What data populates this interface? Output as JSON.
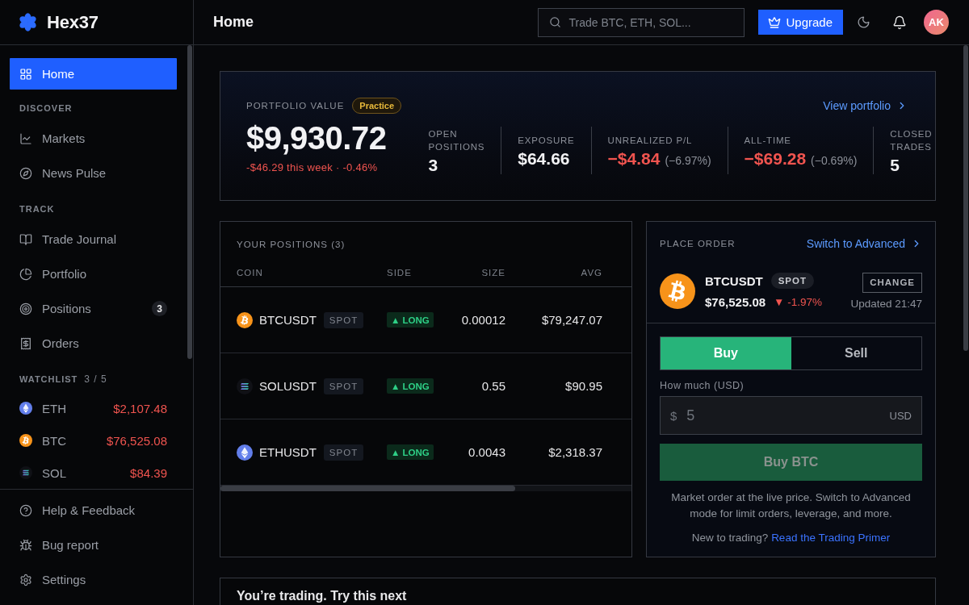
{
  "brand": {
    "name": "Hex37"
  },
  "sidebar": {
    "items": [
      {
        "kind": "home",
        "label": "Home",
        "selected": true
      }
    ],
    "sections": [
      {
        "title": "DISCOVER",
        "items": [
          {
            "kind": "markets",
            "label": "Markets",
            "selected": false
          },
          {
            "kind": "news",
            "label": "News Pulse",
            "selected": false
          }
        ]
      },
      {
        "title": "TRACK",
        "items": [
          {
            "kind": "journal",
            "label": "Trade Journal",
            "selected": false
          },
          {
            "kind": "portfolio",
            "label": "Portfolio",
            "selected": false
          },
          {
            "kind": "positions",
            "label": "Positions",
            "badge": "3",
            "selected": false
          },
          {
            "kind": "orders",
            "label": "Orders",
            "selected": false
          }
        ]
      }
    ],
    "watchlist": {
      "title": "WATCHLIST",
      "count": "3 / 5",
      "items": [
        {
          "kind": "eth",
          "symbol": "ETH",
          "price": "$2,107.48",
          "negative": true
        },
        {
          "kind": "btc",
          "symbol": "BTC",
          "price": "$76,525.08",
          "negative": true
        },
        {
          "kind": "sol",
          "symbol": "SOL",
          "price": "$84.39",
          "negative": true
        }
      ]
    },
    "footer_items": [
      {
        "kind": "help",
        "label": "Help & Feedback",
        "selected": false
      },
      {
        "kind": "bug",
        "label": "Bug report",
        "selected": false
      },
      {
        "kind": "settings",
        "label": "Settings",
        "selected": false
      }
    ]
  },
  "header": {
    "title": "Home",
    "search": {
      "placeholder": "Trade BTC, ETH, SOL..."
    },
    "upgrade": "Upgrade",
    "avatar": "AK"
  },
  "portfolio": {
    "label": "PORTFOLIO VALUE",
    "badge": "Practice",
    "value": "$9,930.72",
    "change": "-$46.29 this week · -0.46%",
    "change_negative": true,
    "link": "View portfolio",
    "stats": [
      {
        "label": "OPEN POSITIONS",
        "value": "3",
        "negative": false
      },
      {
        "label": "EXPOSURE",
        "value": "$64.66",
        "negative": false
      },
      {
        "label": "UNREALIZED P/L",
        "value": "−$4.84",
        "detail": "(−6.97%)",
        "negative": true
      },
      {
        "label": "ALL-TIME",
        "value": "−$69.28",
        "detail": "(−0.69%)",
        "negative": true
      },
      {
        "label": "CLOSED TRADES",
        "value": "5",
        "negative": false
      }
    ]
  },
  "positions": {
    "title": "YOUR POSITIONS (3)",
    "columns": [
      "COIN",
      "SIDE",
      "SIZE",
      "AVG"
    ],
    "rows": [
      {
        "kind": "btc",
        "symbol": "BTCUSDT",
        "market": "SPOT",
        "side": {
          "kind": "long",
          "label": "▲ LONG"
        },
        "size": "0.00012",
        "avg": "$79,247.07"
      },
      {
        "kind": "sol",
        "symbol": "SOLUSDT",
        "market": "SPOT",
        "side": {
          "kind": "long",
          "label": "▲ LONG"
        },
        "size": "0.55",
        "avg": "$90.95"
      },
      {
        "kind": "eth",
        "symbol": "ETHUSDT",
        "market": "SPOT",
        "side": {
          "kind": "long",
          "label": "▲ LONG"
        },
        "size": "0.0043",
        "avg": "$2,318.37"
      }
    ]
  },
  "order": {
    "title": "PLACE ORDER",
    "link": "Switch to Advanced",
    "coin": {
      "kind": "btc",
      "symbol": "BTCUSDT",
      "market": "SPOT",
      "price": "$76,525.08",
      "change": "▼ -1.97%",
      "negative": true,
      "action": "CHANGE",
      "updated": "Updated 21:47"
    },
    "sides": [
      {
        "label": "Buy",
        "selected": true
      },
      {
        "label": "Sell",
        "selected": false
      }
    ],
    "amount": {
      "label": "How much (USD)",
      "prefix": "$",
      "placeholder": "5",
      "suffix": "USD"
    },
    "submit": {
      "label": "Buy BTC",
      "disabled": true
    },
    "note": "Market order at the live price. Switch to Advanced mode for limit orders, leverage, and more.",
    "primer": {
      "text": "New to trading?",
      "link": "Read the Trading Primer"
    }
  },
  "next": {
    "title": "You’re trading. Try this next"
  }
}
